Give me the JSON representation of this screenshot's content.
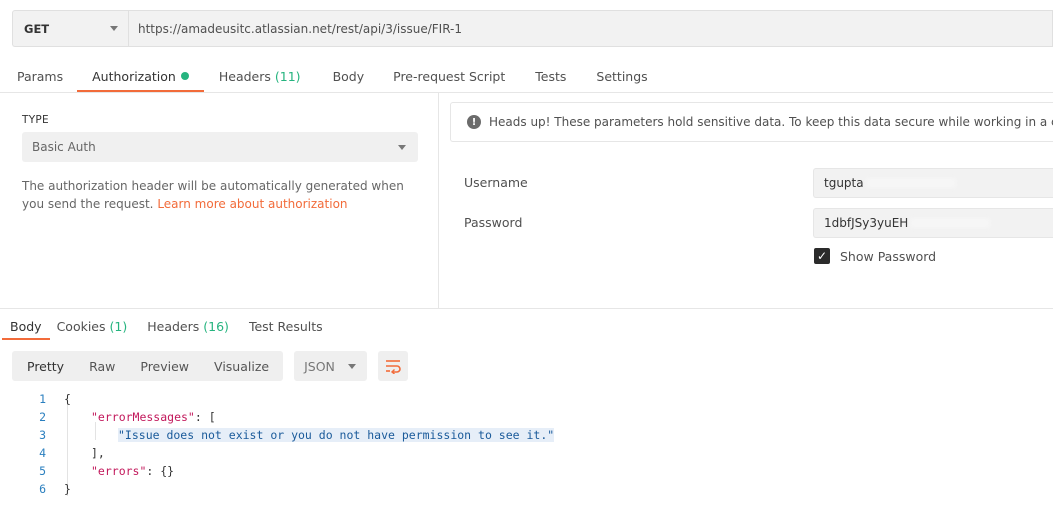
{
  "request": {
    "method": "GET",
    "url": "https://amadeusitc.atlassian.net/rest/api/3/issue/FIR-1"
  },
  "request_tabs": {
    "params": "Params",
    "authorization": "Authorization",
    "headers": "Headers",
    "headers_count": "(11)",
    "body": "Body",
    "prerequest": "Pre-request Script",
    "tests": "Tests",
    "settings": "Settings"
  },
  "auth": {
    "type_label": "TYPE",
    "type_value": "Basic Auth",
    "help_text": "The authorization header will be automatically generated when you send the request.",
    "help_link": "Learn more about authorization",
    "notice": "Heads up! These parameters hold sensitive data. To keep this data secure while working in a collabora",
    "username_label": "Username",
    "username_value": "tgupta",
    "password_label": "Password",
    "password_value": "1dbfJSy3yuEH",
    "show_password_label": "Show Password"
  },
  "response_tabs": {
    "body": "Body",
    "cookies": "Cookies",
    "cookies_count": "(1)",
    "headers": "Headers",
    "headers_count": "(16)",
    "test_results": "Test Results"
  },
  "view_modes": {
    "pretty": "Pretty",
    "raw": "Raw",
    "preview": "Preview",
    "visualize": "Visualize",
    "format": "JSON"
  },
  "response_body": {
    "line_numbers": [
      "1",
      "2",
      "3",
      "4",
      "5",
      "6"
    ],
    "open_brace": "{",
    "error_messages_key": "\"errorMessages\"",
    "open_bracket": ": [",
    "message": "\"Issue does not exist or you do not have permission to see it.\"",
    "close_bracket": "],",
    "errors_key": "\"errors\"",
    "errors_value": ": {}",
    "close_brace": "}"
  }
}
